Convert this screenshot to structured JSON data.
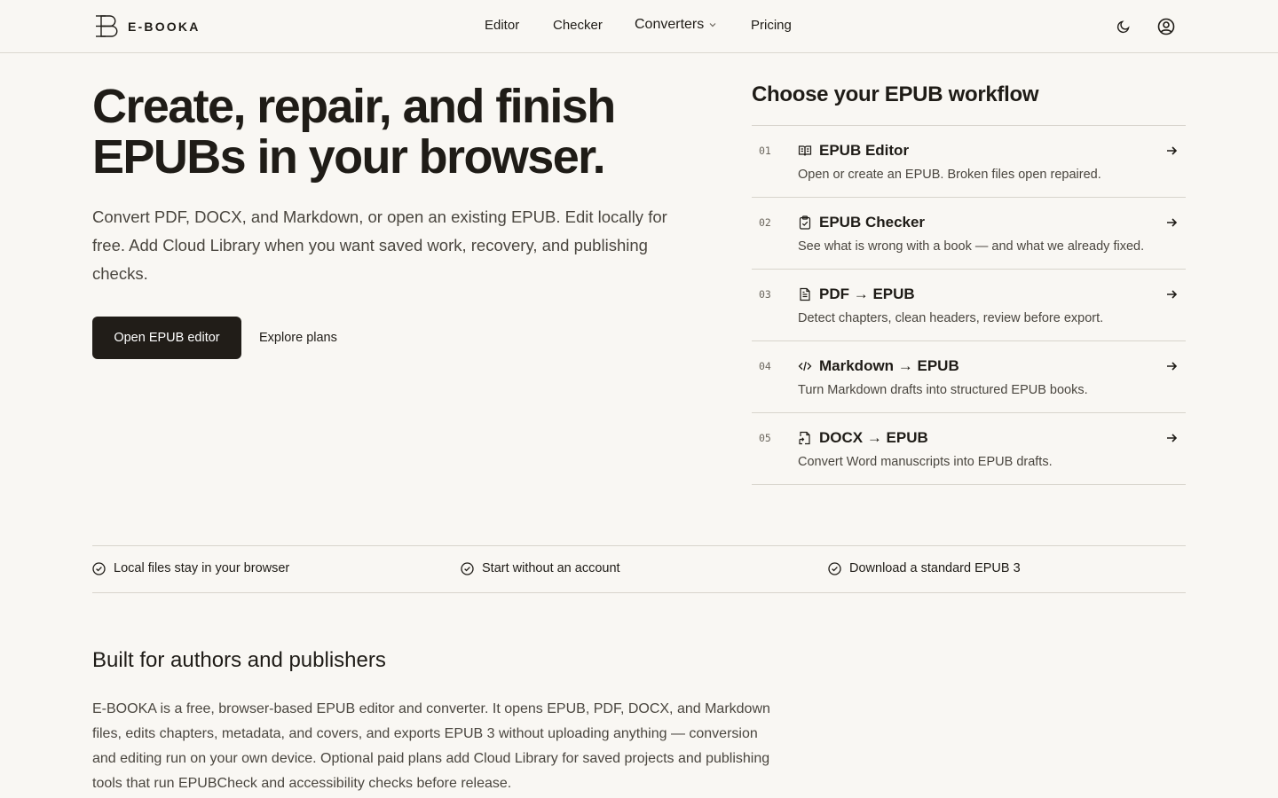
{
  "header": {
    "logo_text": "E-BOOKA",
    "nav": {
      "editor": "Editor",
      "checker": "Checker",
      "converters": "Converters",
      "pricing": "Pricing"
    }
  },
  "hero": {
    "title": "Create, repair, and finish EPUBs in your browser.",
    "subtitle": "Convert PDF, DOCX, and Markdown, or open an existing EPUB. Edit locally for free. Add Cloud Library when you want saved work, recovery, and publishing checks.",
    "primary_button": "Open EPUB editor",
    "secondary_link": "Explore plans"
  },
  "workflow": {
    "title": "Choose your EPUB workflow",
    "items": [
      {
        "num": "01",
        "name": "EPUB Editor",
        "desc": "Open or create an EPUB. Broken files open repaired.",
        "icon": "book-open-icon"
      },
      {
        "num": "02",
        "name": "EPUB Checker",
        "desc": "See what is wrong with a book — and what we already fixed.",
        "icon": "clipboard-check-icon"
      },
      {
        "num": "03",
        "name": "PDF → EPUB",
        "desc": "Detect chapters, clean headers, review before export.",
        "icon": "file-text-icon"
      },
      {
        "num": "04",
        "name": "Markdown → EPUB",
        "desc": "Turn Markdown drafts into structured EPUB books.",
        "icon": "code-icon"
      },
      {
        "num": "05",
        "name": "DOCX → EPUB",
        "desc": "Convert Word manuscripts into EPUB drafts.",
        "icon": "file-convert-icon"
      }
    ]
  },
  "features": [
    "Local files stay in your browser",
    "Start without an account",
    "Download a standard EPUB 3"
  ],
  "built": {
    "title": "Built for authors and publishers",
    "text": "E-BOOKA is a free, browser-based EPUB editor and converter. It opens EPUB, PDF, DOCX, and Markdown files, edits chapters, metadata, and covers, and exports EPUB 3 without uploading anything — conversion and editing run on your own device. Optional paid plans add Cloud Library for saved projects and publishing tools that run EPUBCheck and accessibility checks before release."
  }
}
